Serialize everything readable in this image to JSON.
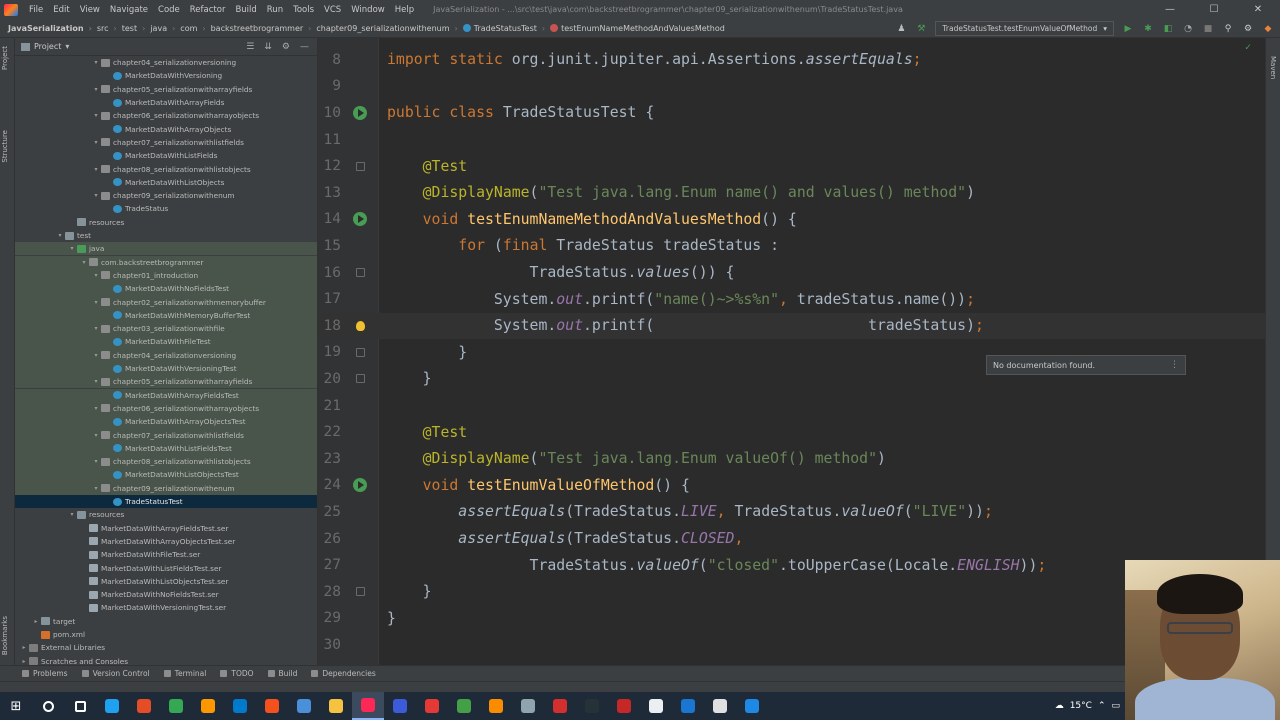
{
  "menubar": {
    "items": [
      "File",
      "Edit",
      "View",
      "Navigate",
      "Code",
      "Refactor",
      "Build",
      "Run",
      "Tools",
      "VCS",
      "Window",
      "Help"
    ],
    "window_title": "JavaSerialization - ...\\src\\test\\java\\com\\backstreetbrogrammer\\chapter09_serializationwithenum\\TradeStatusTest.java"
  },
  "navbar": {
    "breadcrumbs": [
      "JavaSerialization",
      "src",
      "test",
      "java",
      "com",
      "backstreetbrogrammer",
      "chapter09_serializationwithenum",
      "TradeStatusTest",
      "testEnumNameMethodAndValuesMethod"
    ],
    "run_config": "TradeStatusTest.testEnumValueOfMethod"
  },
  "left_strip": {
    "tabs": [
      "Project",
      "Structure",
      "Bookmarks"
    ]
  },
  "right_strip": {
    "tabs": [
      "Maven"
    ]
  },
  "project": {
    "title": "Project",
    "tree": [
      {
        "label": "chapter04_serializationversioning",
        "depth": 6,
        "icon": "pkg",
        "arrow": "▾"
      },
      {
        "label": "MarketDataWithVersioning",
        "depth": 7,
        "icon": "cls"
      },
      {
        "label": "chapter05_serializationwitharrayfields",
        "depth": 6,
        "icon": "pkg",
        "arrow": "▾"
      },
      {
        "label": "MarketDataWithArrayFields",
        "depth": 7,
        "icon": "cls"
      },
      {
        "label": "chapter06_serializationwitharrayobjects",
        "depth": 6,
        "icon": "pkg",
        "arrow": "▾"
      },
      {
        "label": "MarketDataWithArrayObjects",
        "depth": 7,
        "icon": "cls"
      },
      {
        "label": "chapter07_serializationwithlistfields",
        "depth": 6,
        "icon": "pkg",
        "arrow": "▾"
      },
      {
        "label": "MarketDataWithListFields",
        "depth": 7,
        "icon": "cls"
      },
      {
        "label": "chapter08_serializationwithlistobjects",
        "depth": 6,
        "icon": "pkg",
        "arrow": "▾"
      },
      {
        "label": "MarketDataWithListObjects",
        "depth": 7,
        "icon": "cls"
      },
      {
        "label": "chapter09_serializationwithenum",
        "depth": 6,
        "icon": "pkg",
        "arrow": "▾"
      },
      {
        "label": "TradeStatus",
        "depth": 7,
        "icon": "cls"
      },
      {
        "label": "resources",
        "depth": 4,
        "icon": "folder"
      },
      {
        "label": "test",
        "depth": 3,
        "icon": "folder",
        "arrow": "▾"
      },
      {
        "label": "java",
        "depth": 4,
        "icon": "src",
        "arrow": "▾",
        "test": true
      },
      {
        "label": "com.backstreetbrogrammer",
        "depth": 5,
        "icon": "pkg",
        "arrow": "▾",
        "test": true
      },
      {
        "label": "chapter01_introduction",
        "depth": 6,
        "icon": "pkg",
        "arrow": "▾",
        "test": true
      },
      {
        "label": "MarketDataWithNoFieldsTest",
        "depth": 7,
        "icon": "cls",
        "test": true
      },
      {
        "label": "chapter02_serializationwithmemorybuffer",
        "depth": 6,
        "icon": "pkg",
        "arrow": "▾",
        "test": true
      },
      {
        "label": "MarketDataWithMemoryBufferTest",
        "depth": 7,
        "icon": "cls",
        "test": true
      },
      {
        "label": "chapter03_serializationwithfile",
        "depth": 6,
        "icon": "pkg",
        "arrow": "▾",
        "test": true
      },
      {
        "label": "MarketDataWithFileTest",
        "depth": 7,
        "icon": "cls",
        "test": true
      },
      {
        "label": "chapter04_serializationversioning",
        "depth": 6,
        "icon": "pkg",
        "arrow": "▾",
        "test": true
      },
      {
        "label": "MarketDataWithVersioningTest",
        "depth": 7,
        "icon": "cls",
        "test": true
      },
      {
        "label": "chapter05_serializationwitharrayfields",
        "depth": 6,
        "icon": "pkg",
        "arrow": "▾",
        "test": true
      },
      {
        "label": "MarketDataWithArrayFieldsTest",
        "depth": 7,
        "icon": "cls",
        "test": true
      },
      {
        "label": "chapter06_serializationwitharrayobjects",
        "depth": 6,
        "icon": "pkg",
        "arrow": "▾",
        "test": true
      },
      {
        "label": "MarketDataWithArrayObjectsTest",
        "depth": 7,
        "icon": "cls",
        "test": true
      },
      {
        "label": "chapter07_serializationwithlistfields",
        "depth": 6,
        "icon": "pkg",
        "arrow": "▾",
        "test": true
      },
      {
        "label": "MarketDataWithListFieldsTest",
        "depth": 7,
        "icon": "cls",
        "test": true
      },
      {
        "label": "chapter08_serializationwithlistobjects",
        "depth": 6,
        "icon": "pkg",
        "arrow": "▾",
        "test": true
      },
      {
        "label": "MarketDataWithListObjectsTest",
        "depth": 7,
        "icon": "cls",
        "test": true
      },
      {
        "label": "chapter09_serializationwithenum",
        "depth": 6,
        "icon": "pkg",
        "arrow": "▾",
        "test": true
      },
      {
        "label": "TradeStatusTest",
        "depth": 7,
        "icon": "cls",
        "selected": true
      },
      {
        "label": "resources",
        "depth": 4,
        "icon": "folder",
        "arrow": "▾"
      },
      {
        "label": "MarketDataWithArrayFieldsTest.ser",
        "depth": 5,
        "icon": "ser"
      },
      {
        "label": "MarketDataWithArrayObjectsTest.ser",
        "depth": 5,
        "icon": "ser"
      },
      {
        "label": "MarketDataWithFileTest.ser",
        "depth": 5,
        "icon": "ser"
      },
      {
        "label": "MarketDataWithListFieldsTest.ser",
        "depth": 5,
        "icon": "ser"
      },
      {
        "label": "MarketDataWithListObjectsTest.ser",
        "depth": 5,
        "icon": "ser"
      },
      {
        "label": "MarketDataWithNoFieldsTest.ser",
        "depth": 5,
        "icon": "ser"
      },
      {
        "label": "MarketDataWithVersioningTest.ser",
        "depth": 5,
        "icon": "ser"
      },
      {
        "label": "target",
        "depth": 1,
        "icon": "folder",
        "arrow": "▸"
      },
      {
        "label": "pom.xml",
        "depth": 1,
        "icon": "xml"
      },
      {
        "label": "External Libraries",
        "depth": 0,
        "icon": "lib",
        "arrow": "▸"
      },
      {
        "label": "Scratches and Consoles",
        "depth": 0,
        "icon": "lib",
        "arrow": "▸"
      }
    ]
  },
  "editor": {
    "lines": [
      {
        "n": "8",
        "mark": "",
        "tokens": [
          [
            "kw",
            "import static "
          ],
          [
            "",
            "org.junit.jupiter.api.Assertions."
          ],
          [
            "it",
            "assertEquals"
          ],
          [
            "kw",
            ";"
          ]
        ]
      },
      {
        "n": "9",
        "mark": "",
        "tokens": []
      },
      {
        "n": "10",
        "mark": "run",
        "tokens": [
          [
            "kw",
            "public class "
          ],
          [
            "",
            "TradeStatusTest {"
          ]
        ]
      },
      {
        "n": "11",
        "mark": "",
        "tokens": []
      },
      {
        "n": "12",
        "mark": "fold",
        "tokens": [
          [
            "",
            "    "
          ],
          [
            "ann",
            "@Test"
          ]
        ]
      },
      {
        "n": "13",
        "mark": "",
        "tokens": [
          [
            "",
            "    "
          ],
          [
            "ann",
            "@DisplayName"
          ],
          [
            "",
            "("
          ],
          [
            "str",
            "\"Test java.lang.Enum name() and values() method\""
          ],
          [
            "",
            ")"
          ]
        ]
      },
      {
        "n": "14",
        "mark": "run",
        "tokens": [
          [
            "",
            "    "
          ],
          [
            "kw",
            "void "
          ],
          [
            "fn",
            "testEnumNameMethodAndValuesMethod"
          ],
          [
            "",
            "() {"
          ]
        ]
      },
      {
        "n": "15",
        "mark": "",
        "tokens": [
          [
            "",
            "        "
          ],
          [
            "kw",
            "for "
          ],
          [
            "",
            "("
          ],
          [
            "kw",
            "final "
          ],
          [
            "",
            "TradeStatus tradeStatus :"
          ]
        ]
      },
      {
        "n": "16",
        "mark": "fold",
        "tokens": [
          [
            "",
            "                TradeStatus."
          ],
          [
            "it",
            "values"
          ],
          [
            "",
            "()) {"
          ]
        ]
      },
      {
        "n": "17",
        "mark": "",
        "tokens": [
          [
            "",
            "            System."
          ],
          [
            "sfield",
            "out"
          ],
          [
            "",
            ".printf("
          ],
          [
            "str",
            "\"name()~>%s%n\""
          ],
          [
            "kw",
            ", "
          ],
          [
            "",
            "tradeStatus.name())"
          ],
          [
            "kw",
            ";"
          ]
        ]
      },
      {
        "n": "18",
        "mark": "bulb",
        "current": true,
        "tokens": [
          [
            "",
            "            System."
          ],
          [
            "sfield",
            "out"
          ],
          [
            "",
            ".printf(                        tradeStatus)"
          ],
          [
            "kw",
            ";"
          ]
        ]
      },
      {
        "n": "19",
        "mark": "fold",
        "tokens": [
          [
            "",
            "        }"
          ]
        ]
      },
      {
        "n": "20",
        "mark": "fold",
        "tokens": [
          [
            "",
            "    }"
          ]
        ]
      },
      {
        "n": "21",
        "mark": "",
        "tokens": []
      },
      {
        "n": "22",
        "mark": "",
        "tokens": [
          [
            "",
            "    "
          ],
          [
            "ann",
            "@Test"
          ]
        ]
      },
      {
        "n": "23",
        "mark": "",
        "tokens": [
          [
            "",
            "    "
          ],
          [
            "ann",
            "@DisplayName"
          ],
          [
            "",
            "("
          ],
          [
            "str",
            "\"Test java.lang.Enum valueOf() method\""
          ],
          [
            "",
            ")"
          ]
        ]
      },
      {
        "n": "24",
        "mark": "run",
        "tokens": [
          [
            "",
            "    "
          ],
          [
            "kw",
            "void "
          ],
          [
            "fn",
            "testEnumValueOfMethod"
          ],
          [
            "",
            "() {"
          ]
        ]
      },
      {
        "n": "25",
        "mark": "",
        "tokens": [
          [
            "",
            "        "
          ],
          [
            "it",
            "assertEquals"
          ],
          [
            "",
            "(TradeStatus."
          ],
          [
            "sfield",
            "LIVE"
          ],
          [
            "kw",
            ", "
          ],
          [
            "",
            "TradeStatus."
          ],
          [
            "it",
            "valueOf"
          ],
          [
            "",
            "("
          ],
          [
            "str",
            "\"LIVE\""
          ],
          [
            "",
            "))"
          ],
          [
            "kw",
            ";"
          ]
        ]
      },
      {
        "n": "26",
        "mark": "",
        "tokens": [
          [
            "",
            "        "
          ],
          [
            "it",
            "assertEquals"
          ],
          [
            "",
            "(TradeStatus."
          ],
          [
            "sfield",
            "CLOSED"
          ],
          [
            "kw",
            ","
          ]
        ]
      },
      {
        "n": "27",
        "mark": "",
        "tokens": [
          [
            "",
            "                TradeStatus."
          ],
          [
            "it",
            "valueOf"
          ],
          [
            "",
            "("
          ],
          [
            "str",
            "\"closed\""
          ],
          [
            "",
            ".toUpperCase(Locale."
          ],
          [
            "sfield",
            "ENGLISH"
          ],
          [
            "",
            "))"
          ],
          [
            "kw",
            ";"
          ]
        ]
      },
      {
        "n": "28",
        "mark": "fold",
        "tokens": [
          [
            "",
            "    }"
          ]
        ]
      },
      {
        "n": "29",
        "mark": "",
        "tokens": [
          [
            "",
            "}"
          ]
        ]
      },
      {
        "n": "30",
        "mark": "",
        "tokens": []
      }
    ],
    "tooltip": "No documentation found."
  },
  "bottom_tabs": [
    "Problems",
    "Version Control",
    "Terminal",
    "TODO",
    "Build",
    "Dependencies"
  ],
  "taskbar": {
    "icons": [
      {
        "name": "search",
        "color": "#ffffff"
      },
      {
        "name": "task-view",
        "color": "#ffffff"
      },
      {
        "name": "edge",
        "color": "#1ea1f1"
      },
      {
        "name": "app-red",
        "color": "#e44d26"
      },
      {
        "name": "chrome",
        "color": "#34a853"
      },
      {
        "name": "sublime",
        "color": "#ff9800"
      },
      {
        "name": "vscode",
        "color": "#007acc"
      },
      {
        "name": "app-orange",
        "color": "#f4511e"
      },
      {
        "name": "app-blue",
        "color": "#4a90d9"
      },
      {
        "name": "explorer",
        "color": "#f5c242"
      },
      {
        "name": "intellij",
        "color": "#fe2857",
        "active": true
      },
      {
        "name": "app-purple",
        "color": "#3b5bdb"
      },
      {
        "name": "app-red2",
        "color": "#e53935"
      },
      {
        "name": "app-green",
        "color": "#43a047"
      },
      {
        "name": "app-orange2",
        "color": "#fb8c00"
      },
      {
        "name": "app-grey",
        "color": "#90a4ae"
      },
      {
        "name": "app-red3",
        "color": "#d32f2f"
      },
      {
        "name": "app-dark",
        "color": "#263238"
      },
      {
        "name": "app-red4",
        "color": "#c62828"
      },
      {
        "name": "app-white",
        "color": "#eceff1"
      },
      {
        "name": "app-blue2",
        "color": "#1976d2"
      },
      {
        "name": "app-white2",
        "color": "#e0e0e0"
      },
      {
        "name": "app-blue3",
        "color": "#1e88e5"
      }
    ],
    "weather": "15°C"
  }
}
